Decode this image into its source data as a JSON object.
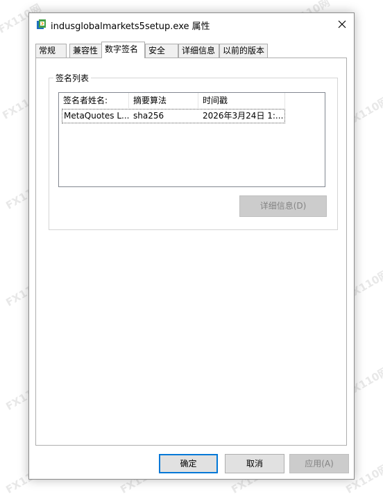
{
  "window": {
    "title": "indusglobalmarkets5setup.exe 属性"
  },
  "tabs": [
    {
      "label": "常规",
      "active": false
    },
    {
      "label": "兼容性",
      "active": false
    },
    {
      "label": "数字签名",
      "active": true
    },
    {
      "label": "安全",
      "active": false
    },
    {
      "label": "详细信息",
      "active": false
    },
    {
      "label": "以前的版本",
      "active": false
    }
  ],
  "signature_group": {
    "label": "签名列表",
    "columns": [
      "签名者姓名:",
      "摘要算法",
      "时间戳"
    ],
    "rows": [
      {
        "signer": "MetaQuotes L...",
        "digest": "sha256",
        "timestamp": "2026年3月24日 1:..."
      }
    ],
    "details_button": "详细信息(D)"
  },
  "footer": {
    "ok": "确定",
    "cancel": "取消",
    "apply": "应用(A)"
  },
  "watermark": "FX110网",
  "colors": {
    "accent": "#0078d7",
    "disabled_button": "#cccccc",
    "disabled_text": "#838383"
  }
}
